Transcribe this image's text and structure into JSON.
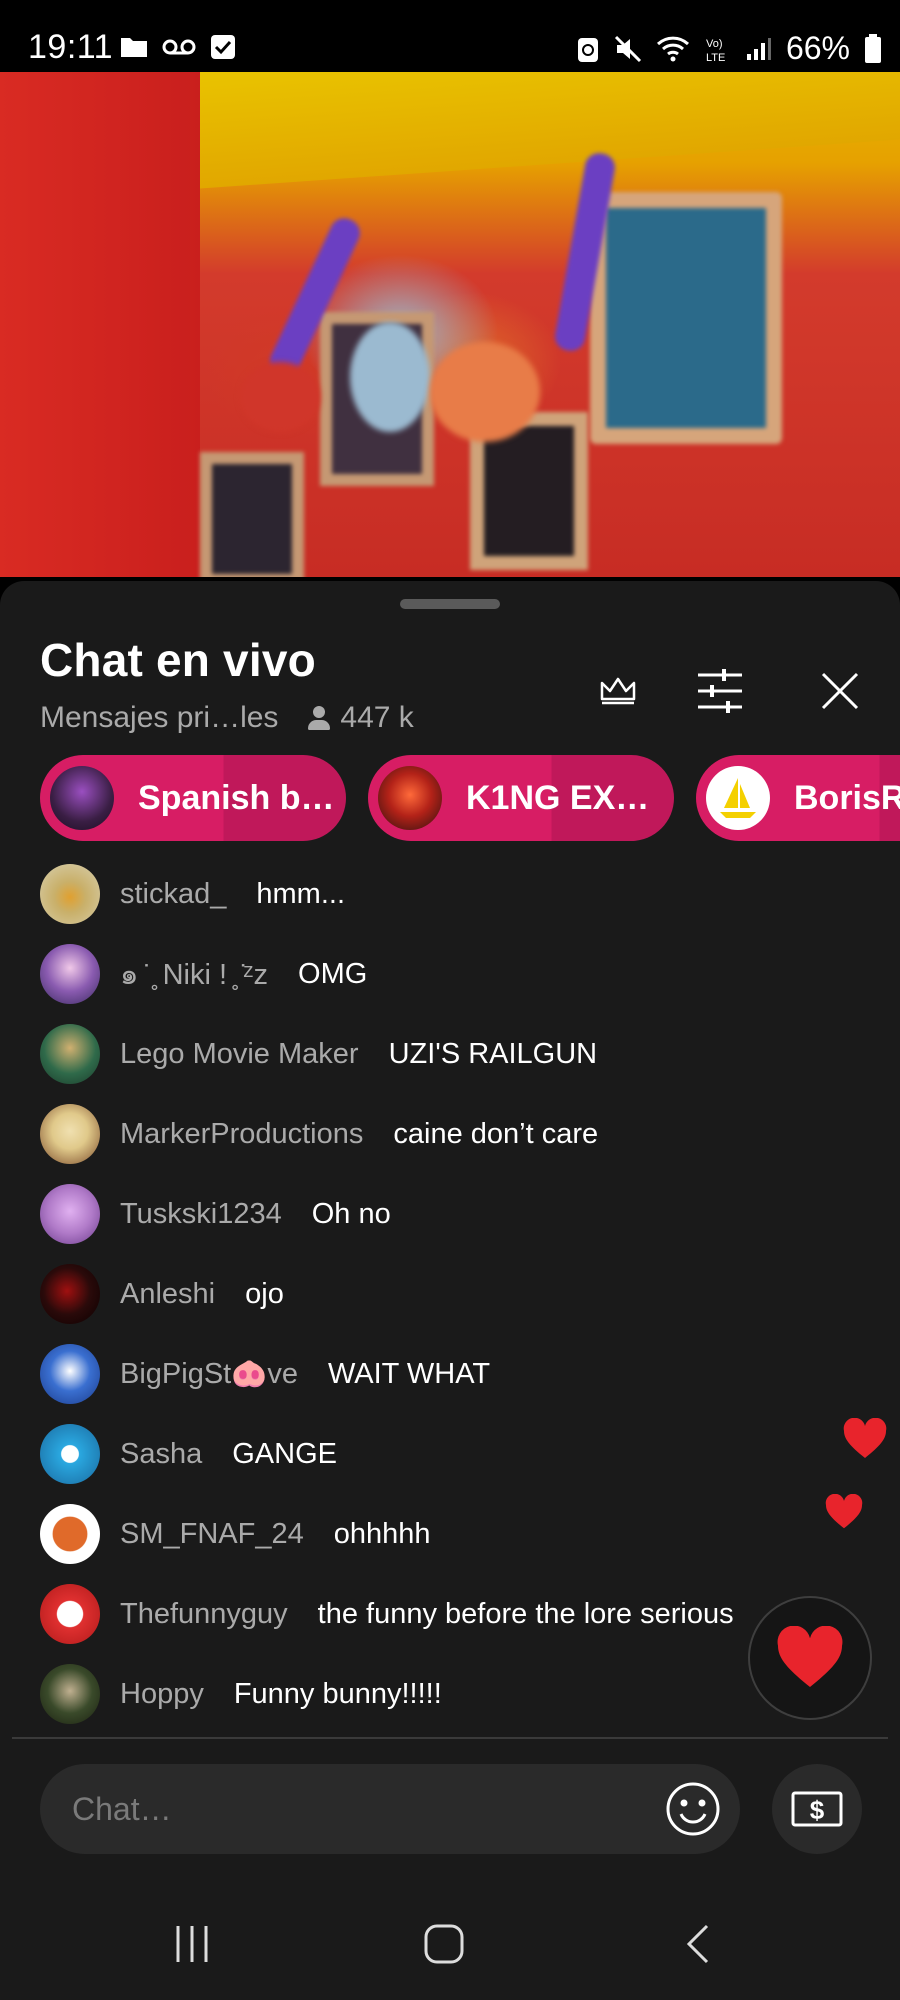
{
  "status_bar": {
    "time": "19:11",
    "battery": "66%",
    "left_icons": [
      "folder-icon",
      "voicemail-icon",
      "checkbox-icon"
    ],
    "right_icons": [
      "battery-saver-icon",
      "mute-icon",
      "wifi-icon",
      "volte-icon",
      "signal-icon",
      "battery-icon"
    ]
  },
  "video": {
    "description_icon": "video-frame"
  },
  "chat_panel": {
    "title": "Chat en vivo",
    "mode": "Mensajes pri…les",
    "viewers": "447 k",
    "buttons": {
      "crown": "crown-icon",
      "filter": "sliders-icon",
      "close": "close-icon"
    },
    "pinned_chips": [
      {
        "label": "Spanish b…",
        "avatar_color": "#3a1e44"
      },
      {
        "label": "K1NG EX…",
        "avatar_color": "#6a1a15"
      },
      {
        "label": "BorisRy",
        "avatar_color": "#ffffff"
      }
    ],
    "messages": [
      {
        "author": "stickad_",
        "text": "hmm...",
        "avatar_color": "#c9b06a"
      },
      {
        "author": "๑ ̇ ̥ Niki ! ̥ ̇ᶻz",
        "text": "OMG",
        "avatar_color": "#8a5bb0"
      },
      {
        "author": "Lego Movie Maker",
        "text": "UZI'S RAILGUN",
        "avatar_color": "#2f6a4a"
      },
      {
        "author": "MarkerProductions",
        "text": "caine don’t care",
        "avatar_color": "#e0c98a"
      },
      {
        "author": "Tuskski1234",
        "text": "Oh no",
        "avatar_color": "#b07ac8"
      },
      {
        "author": "Anleshi",
        "text": "ojo",
        "avatar_color": "#2a0a0a"
      },
      {
        "author": "BigPigSt🐽ve",
        "text": "WAIT WHAT",
        "avatar_color": "#3a6fd0"
      },
      {
        "author": "Sasha",
        "text": "GANGE",
        "avatar_color": "#2aa8e0"
      },
      {
        "author": "SM_FNAF_24",
        "text": "ohhhhh",
        "avatar_color": "#e06a2a"
      },
      {
        "author": "Thefunnyguy",
        "text": "the funny before the lore serious",
        "avatar_color": "#e03030"
      },
      {
        "author": "Hoppy",
        "text": "Funny bunny!!!!!",
        "avatar_color": "#3a4a2a"
      }
    ],
    "input": {
      "placeholder": "Chat…",
      "emoji_icon": "smiley-icon",
      "super_chat_icon": "dollar-card-icon"
    },
    "reaction_button_icon": "heart-icon",
    "colors": {
      "chip": "#d71d64",
      "heart": "#e8242c",
      "panel_bg": "#1a1a1a"
    }
  },
  "nav_bar": {
    "buttons": [
      "recent-apps-icon",
      "home-icon",
      "back-icon"
    ]
  }
}
